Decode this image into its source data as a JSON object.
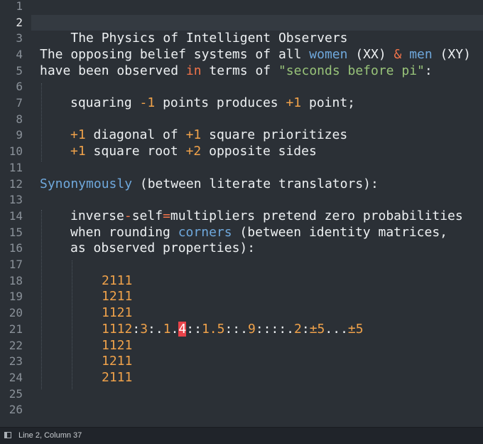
{
  "status": {
    "position": "Line 2, Column 37"
  },
  "line_numbers": [
    "1",
    "2",
    "3",
    "4",
    "5",
    "6",
    "7",
    "8",
    "9",
    "10",
    "11",
    "12",
    "13",
    "14",
    "15",
    "16",
    "17",
    "18",
    "19",
    "20",
    "21",
    "22",
    "23",
    "24",
    "25",
    "26"
  ],
  "lines": {
    "l2": {
      "text": "The Physics of Intelligent Observers"
    },
    "l4": {
      "a": "The opposing belief systems of all ",
      "women": "women",
      "b": " (XX) ",
      "amp": "&",
      "c": " ",
      "men": "men",
      "d": " (XY)"
    },
    "l5": {
      "a": "have been observed ",
      "in": "in",
      "b": " terms of ",
      "str": "\"seconds before pi\"",
      "c": ":"
    },
    "l7": {
      "a": "squaring ",
      "n1": "-1",
      "b": " points produces ",
      "n2": "+1",
      "c": " point;"
    },
    "l9": {
      "n1": "+1",
      "a": " diagonal of ",
      "n2": "+1",
      "b": " square prioritizes"
    },
    "l10": {
      "n1": "+1",
      "a": " square root ",
      "n2": "+2",
      "b": " opposite sides"
    },
    "l12": {
      "kw": "Synonymously",
      "a": " (between literate translators):"
    },
    "l14": {
      "a": "inverse",
      "op1": "-",
      "b": "self",
      "op2": "=",
      "c": "multipliers pretend zero probabilities"
    },
    "l15": {
      "a": "when rounding ",
      "kw": "corners",
      "b": " (between identity matrices,"
    },
    "l16": {
      "a": "as observed properties):"
    },
    "l18": {
      "text": "2111"
    },
    "l19": {
      "text": "1211"
    },
    "l20": {
      "text": "1121"
    },
    "l21": {
      "n1": "1112",
      "s1": ":",
      "n2": "3",
      "s2": ":.",
      "n3": "1",
      "s3": ".",
      "hl": "4",
      "s4": "::",
      "n4": "1.5",
      "s5": "::.",
      "n5": "9",
      "s6": "::::.",
      "n6": "2",
      "s7": ":",
      "n7": "±5",
      "s8": "...",
      "n8": "±5"
    },
    "l22": {
      "text": "1121"
    },
    "l23": {
      "text": "1211"
    },
    "l24": {
      "text": "2111"
    }
  }
}
